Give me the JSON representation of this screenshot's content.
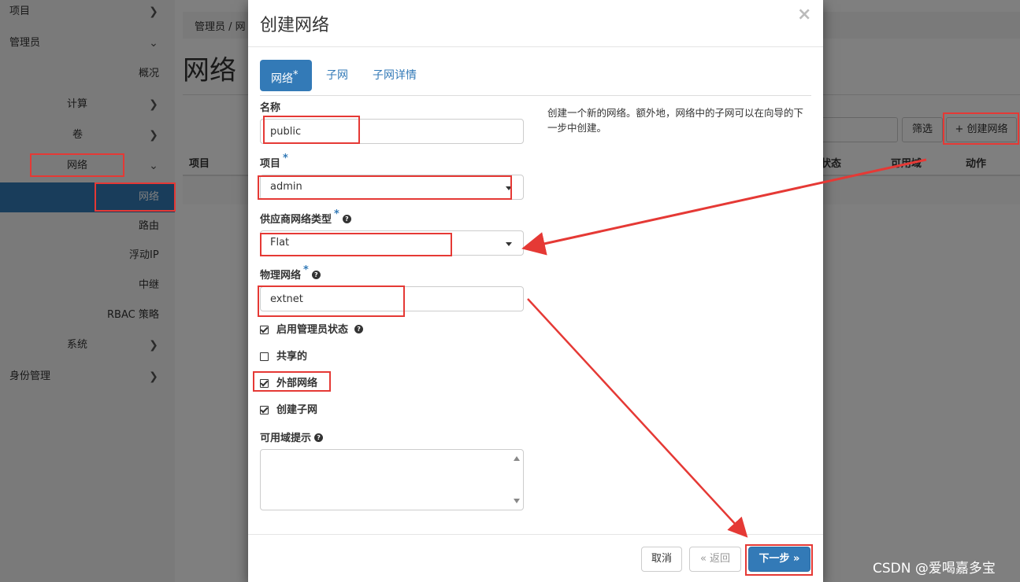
{
  "sidebar": {
    "items": [
      {
        "label": "项目"
      },
      {
        "label": "管理员"
      },
      {
        "label": "概况"
      },
      {
        "label": "计算"
      },
      {
        "label": "卷"
      },
      {
        "label": "网络"
      },
      {
        "label": "网络"
      },
      {
        "label": "路由"
      },
      {
        "label": "浮动IP"
      },
      {
        "label": "中继"
      },
      {
        "label": "RBAC 策略"
      },
      {
        "label": "系统"
      },
      {
        "label": "身份管理"
      }
    ]
  },
  "page": {
    "breadcrumb": "管理员 /  网",
    "title": "网络",
    "filter_button": "筛选",
    "create_button": "+ 创建网络",
    "columns": {
      "project": "项目",
      "status": "状态",
      "az": "可用域",
      "actions": "动作"
    }
  },
  "modal": {
    "title": "创建网络",
    "close": "×",
    "tabs": [
      "网络",
      "子网",
      "子网详情"
    ],
    "tab_required_mark": "*",
    "help_text": "创建一个新的网络。额外地，网络中的子网可以在向导的下一步中创建。",
    "form": {
      "name_label": "名称",
      "name_value": "public",
      "project_label": "项目",
      "project_value": "admin",
      "provider_type_label": "供应商网络类型",
      "provider_type_value": "Flat",
      "physical_network_label": "物理网络",
      "physical_network_value": "extnet",
      "admin_state_label": "启用管理员状态",
      "shared_label": "共享的",
      "external_label": "外部网络",
      "create_subnet_label": "创建子网",
      "az_hints_label": "可用域提示",
      "required_mark": "*",
      "help_icon": "?"
    },
    "footer": {
      "cancel": "取消",
      "back": "« 返回",
      "next": "下一步 »"
    }
  },
  "watermark": "CSDN @爱喝嘉多宝",
  "colors": {
    "primary": "#337ab7",
    "annotation_red": "#e53935"
  }
}
